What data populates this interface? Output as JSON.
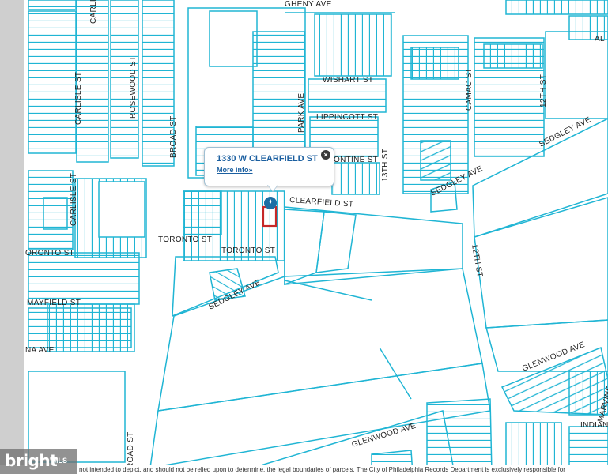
{
  "map": {
    "parcel_color": "#20b5d4",
    "selected_parcel_color": "#c62828",
    "streets": {
      "broad_st_north": "BROAD ST",
      "broad_st_south": "BROAD ST",
      "carlisle_st_north": "CARLISLE ST",
      "carlisle_st_west": "CARLISLE ST",
      "carlisle_st_top": "CARLI",
      "rosewood_st": "ROSEWOOD ST",
      "park_ave": "PARK AVE",
      "wishart_st": "WISHART ST",
      "lippincott_st": "LIPPINCOTT ST",
      "ontine_st": "ONTINE ST",
      "thirteenth_st": "13TH ST",
      "camac_st": "CAMAC ST",
      "twelfth_st_north": "12TH ST",
      "twelfth_st_south": "12TH ST",
      "sedgley_ave_ne": "SEDGLEY AVE",
      "sedgley_ave_mid": "SEDGLEY AVE",
      "sedgley_ave_sw": "SEDGLEY AVE",
      "clearfield_st": "CLEARFIELD ST",
      "toronto_st_a": "TORONTO ST",
      "toronto_st_b": "TORONTO ST",
      "toronto_st_c": "ORONTO ST",
      "mayfield_st": "MAYFIELD ST",
      "na_ave": "NA AVE",
      "glenwood_ave_east": "GLENWOOD AVE",
      "glenwood_ave_south": "GLENWOOD AVE",
      "marvine_st": "MARVINE ST",
      "indiana": "INDIANA",
      "top_ave": "GHENY AVE",
      "all_partial": "AL"
    },
    "marker_icon": "map-pin-icon"
  },
  "popup": {
    "title": "1330 W CLEARFIELD ST",
    "link": "More info»",
    "close_icon": "close-icon"
  },
  "footer": {
    "disclaimer": "not intended to depict, and should not be relied upon to determine, the legal boundaries of parcels. The City of Philadelphia Records Department is exclusively responsible for"
  },
  "watermark": {
    "brand": "bright",
    "sub": "MLS"
  }
}
